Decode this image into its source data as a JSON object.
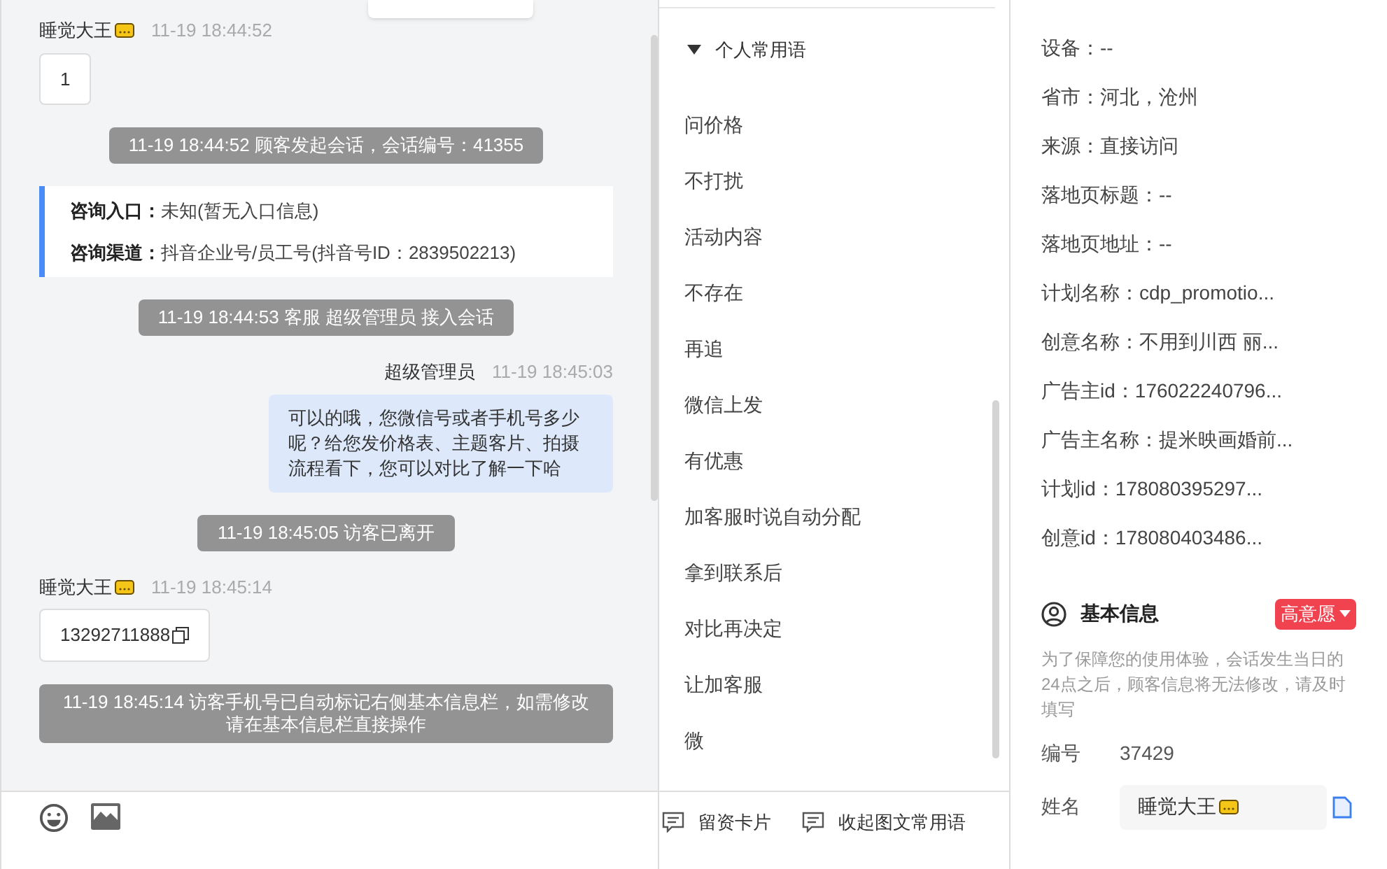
{
  "chat": {
    "messages": [
      {
        "kind": "customer",
        "name": "睡觉大王",
        "time": "11-19 18:44:52",
        "text": "1",
        "copy": false
      },
      {
        "kind": "system",
        "text": "11-19 18:44:52 顾客发起会话，会话编号：41355"
      },
      {
        "kind": "info",
        "rows": [
          {
            "label": "咨询入口：",
            "value": "未知(暂无入口信息)"
          },
          {
            "label": "咨询渠道：",
            "value": "抖音企业号/员工号(抖音号ID：2839502213)"
          }
        ]
      },
      {
        "kind": "system",
        "text": "11-19 18:44:53 客服 超级管理员 接入会话"
      },
      {
        "kind": "agent",
        "name": "超级管理员",
        "time": "11-19 18:45:03",
        "text": "可以的哦，您微信号或者手机号多少呢？给您发价格表、主题客片、拍摄流程看下，您可以对比了解一下哈"
      },
      {
        "kind": "system",
        "text": "11-19 18:45:05 访客已离开"
      },
      {
        "kind": "customer",
        "name": "睡觉大王",
        "time": "11-19 18:45:14",
        "text": "13292711888",
        "copy": true
      },
      {
        "kind": "system",
        "text": "11-19 18:45:14 访客手机号已自动标记右侧基本信息栏，如需修改请在基本信息栏直接操作"
      }
    ]
  },
  "phrases": {
    "group": {
      "title": "个人常用语",
      "expanded": true
    },
    "items": [
      "问价格",
      "不打扰",
      "活动内容",
      "不存在",
      "再追",
      "微信上发",
      "有优惠",
      "加客服时说自动分配",
      "拿到联系后",
      "对比再决定",
      "让加客服",
      "微"
    ],
    "actions": [
      "留资卡片",
      "收起图文常用语"
    ]
  },
  "details": {
    "fields": [
      {
        "text": "设备：--"
      },
      {
        "label": "省市：",
        "value": "河北，沧州"
      },
      {
        "label": "来源：",
        "value": "直接访问"
      },
      {
        "text": "落地页标题：--"
      },
      {
        "text": "落地页地址：--"
      },
      {
        "label": "计划名称：",
        "value": "cdp_promotio..."
      },
      {
        "label": "创意名称：",
        "value": "不用到川西 丽..."
      },
      {
        "label": "广告主id：",
        "value": "176022240796..."
      },
      {
        "label": "广告主名称：",
        "value": "提米映画婚前..."
      },
      {
        "label": "计划id：",
        "value": "178080395297..."
      },
      {
        "label": "创意id：",
        "value": "178080403486..."
      }
    ]
  },
  "basic": {
    "title": "基本信息",
    "tag": {
      "label": "高意愿",
      "color": "#f0424f"
    },
    "note": "为了保障您的使用体验，会话发生当日的24点之后，顾客信息将无法修改，请及时填写",
    "rows": [
      {
        "kind": "text",
        "label": "编号",
        "value": "37429"
      },
      {
        "kind": "input",
        "label": "姓名",
        "value": "睡觉大王"
      }
    ]
  }
}
